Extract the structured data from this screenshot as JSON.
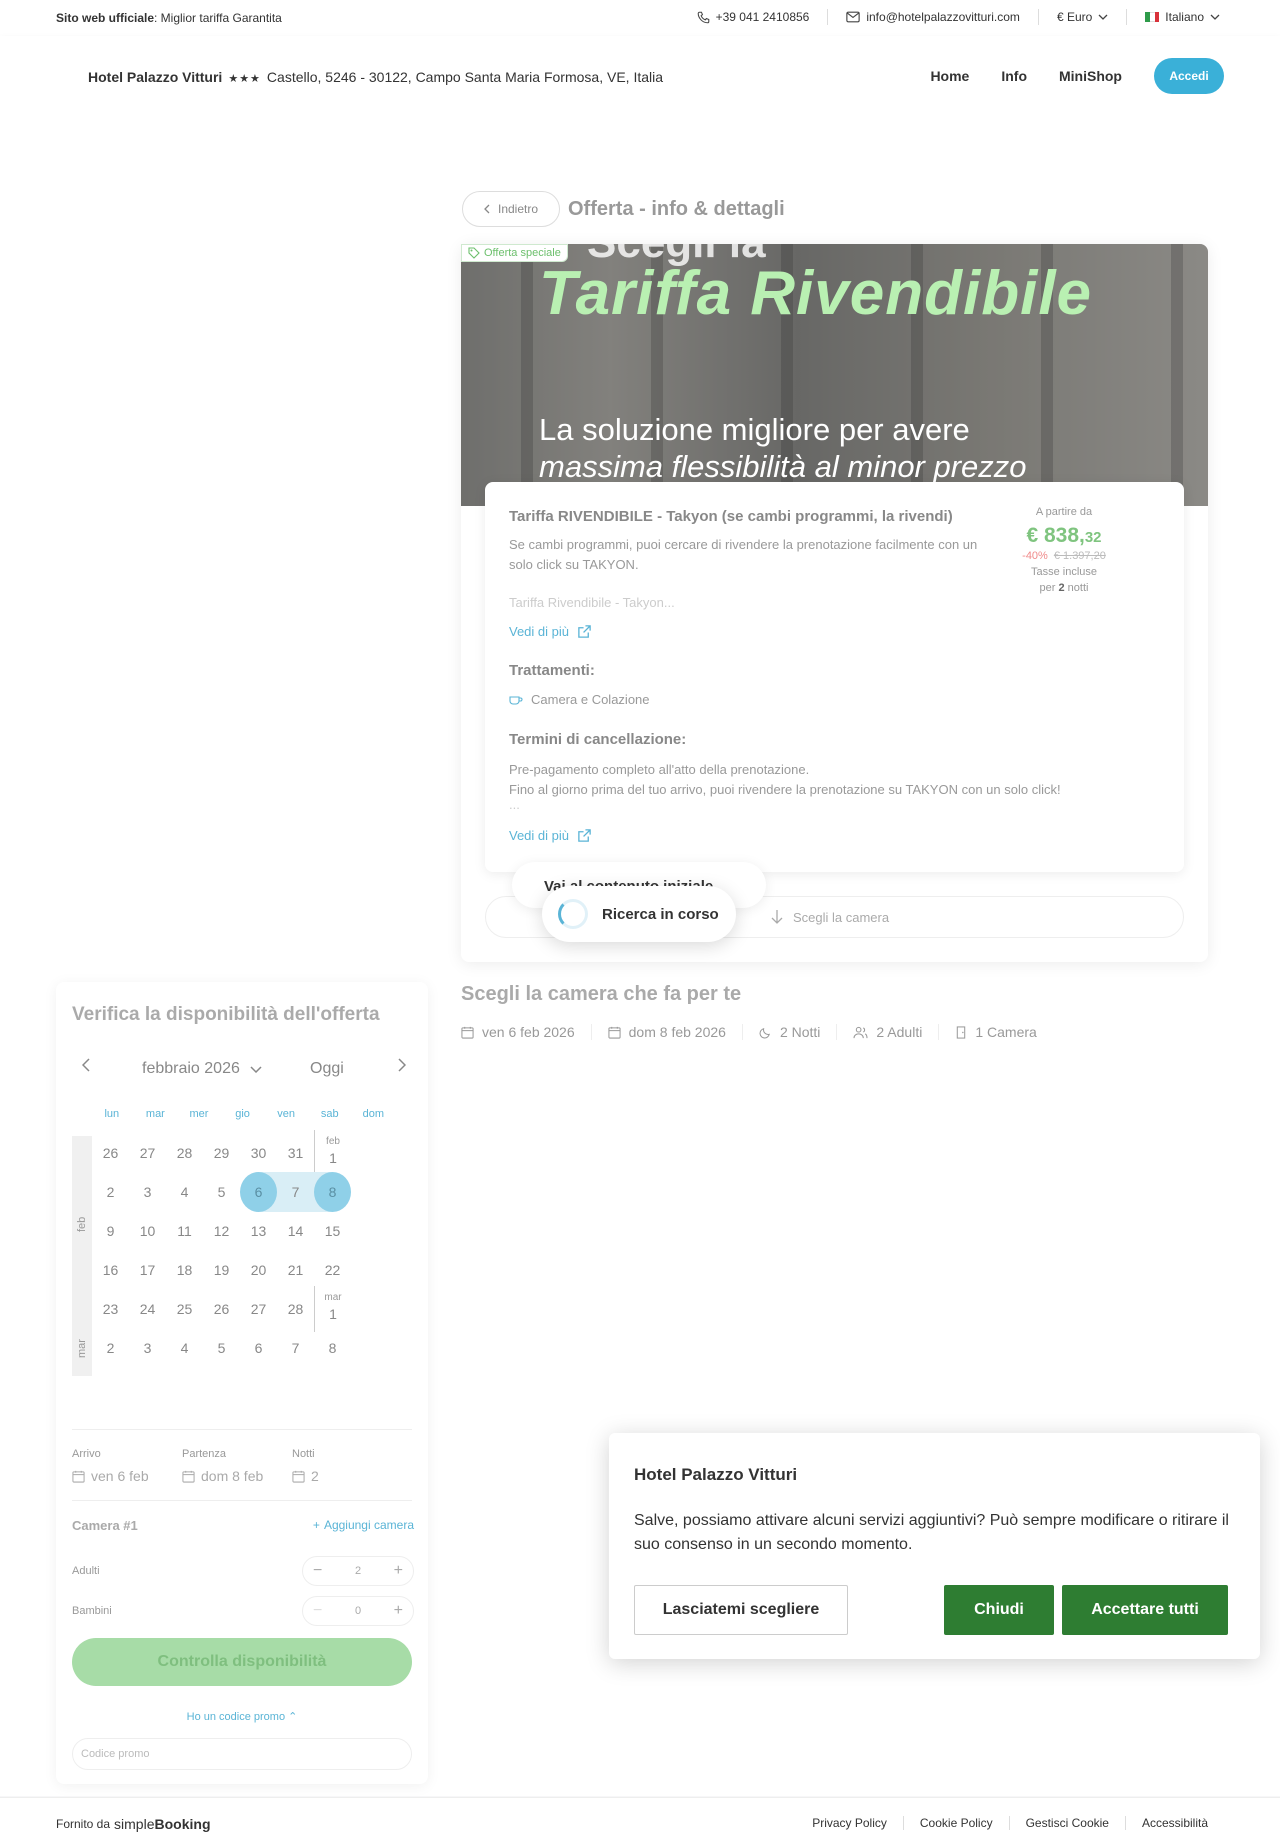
{
  "topbar": {
    "official_label": "Sito web ufficiale",
    "official_text": ": Miglior tariffa Garantita",
    "phone": "+39 041 2410856",
    "email": "info@hotelpalazzovitturi.com",
    "currency": "€ Euro",
    "language": "Italiano"
  },
  "header": {
    "hotel_name": "Hotel Palazzo Vitturi",
    "stars": "★★★",
    "address": "Castello, 5246 - 30122, Campo Santa Maria Formosa, VE, Italia",
    "nav": [
      "Home",
      "Info",
      "MiniShop"
    ],
    "login": "Accedi"
  },
  "page": {
    "back": "Indietro",
    "title": "Offerta - info & dettagli"
  },
  "offer": {
    "badge": "Offerta speciale",
    "banner_top": "Scegli la",
    "banner_title": "Tariffa Rivendibile",
    "banner_line1": "La soluzione migliore per avere",
    "banner_line2": "massima flessibilità al minor prezzo",
    "rate_name": "Tariffa RIVENDIBILE - Takyon (se cambi programmi, la rivendi)",
    "rate_desc": "Se cambi programmi, puoi cercare di rivendere la prenotazione facilmente con un solo click su TAKYON.",
    "rate_fade": "Tariffa Rivendibile - Takyon...",
    "see_more": "Vedi di più",
    "treatments_title": "Trattamenti:",
    "treatment": "Camera e Colazione",
    "cancel_title": "Termini di cancellazione:",
    "cancel_line1": "Pre-pagamento completo all'atto della prenotazione.",
    "cancel_line2": "Fino al giorno prima del tuo arrivo, puoi rivendere la prenotazione su TAKYON con un solo click!",
    "cancel_line3": "...",
    "see_more_2": "Vedi di più",
    "price": {
      "from": "A partire da",
      "amount_main": "€ 838,",
      "amount_cents": "32",
      "discount": "-40%",
      "old": "€ 1.397,20",
      "taxes": "Tasse incluse",
      "nights_prefix": "per ",
      "nights_count": "2",
      "nights_suffix": " notti"
    },
    "behind_pill": "Vai al contenuto iniziale",
    "loading": "Ricerca in corso",
    "choose_room": "Scegli la camera"
  },
  "rooms": {
    "title": "Scegli la camera che fa per te",
    "meta": [
      "ven 6 feb 2026",
      "dom 8 feb 2026",
      "2 Notti",
      "2 Adulti",
      "1 Camera"
    ]
  },
  "calendar": {
    "title": "Verifica la disponibilità dell'offerta",
    "month": "febbraio 2026",
    "today": "Oggi",
    "dow": [
      "lun",
      "mar",
      "mer",
      "gio",
      "ven",
      "sab",
      "dom"
    ],
    "month_labels": [
      "feb",
      "mar"
    ],
    "rows": [
      [
        "26",
        "27",
        "28",
        "29",
        "30",
        "31",
        "1"
      ],
      [
        "2",
        "3",
        "4",
        "5",
        "6",
        "7",
        "8"
      ],
      [
        "9",
        "10",
        "11",
        "12",
        "13",
        "14",
        "15"
      ],
      [
        "16",
        "17",
        "18",
        "19",
        "20",
        "21",
        "22"
      ],
      [
        "23",
        "24",
        "25",
        "26",
        "27",
        "28",
        "1"
      ],
      [
        "2",
        "3",
        "4",
        "5",
        "6",
        "7",
        "8"
      ]
    ],
    "sub_feb": "feb",
    "sub_mar": "mar",
    "arrival_label": "Arrivo",
    "arrival": "ven 6 feb",
    "departure_label": "Partenza",
    "departure": "dom 8 feb",
    "nights_label": "Notti",
    "nights": "2",
    "room_title": "Camera #1",
    "add_room": "Aggiungi camera",
    "adults_label": "Adulti",
    "adults": "2",
    "children_label": "Bambini",
    "children": "0",
    "cta": "Controlla disponibilità",
    "promo_toggle": "Ho un codice promo",
    "promo_placeholder": "Codice promo"
  },
  "cookie": {
    "title": "Hotel Palazzo Vitturi",
    "message": "Salve, possiamo attivare alcuni servizi aggiuntivi? Può sempre modificare o ritirare il suo consenso in un secondo momento.",
    "choose": "Lasciatemi scegliere",
    "close": "Chiudi",
    "accept": "Accettare tutti"
  },
  "footer": {
    "powered": "Fornito da",
    "brand_a": "simple",
    "brand_b": "Booking",
    "links": [
      "Privacy Policy",
      "Cookie Policy",
      "Gestisci Cookie",
      "Accessibilità"
    ]
  },
  "colors": {
    "accent": "#3ab0d8",
    "green_button": "#2e7d32",
    "price_green": "#7fc47f"
  }
}
